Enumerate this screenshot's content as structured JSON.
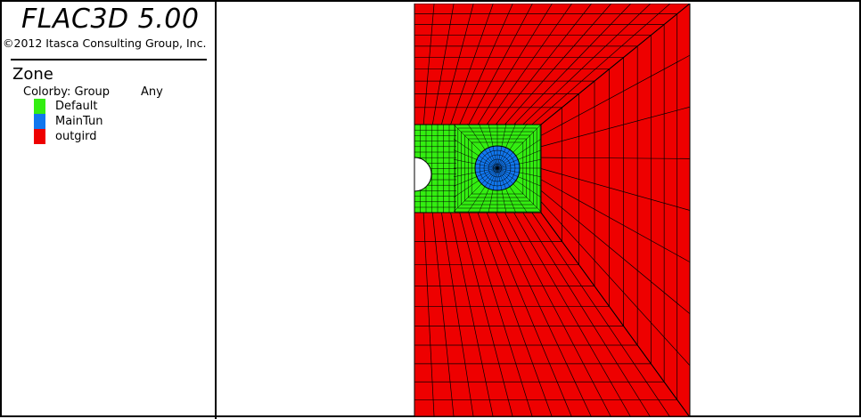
{
  "app": {
    "title": "FLAC3D 5.00",
    "copyright": "©2012 Itasca Consulting Group, Inc."
  },
  "legend": {
    "section": "Zone",
    "colorby_label": "Colorby: Group",
    "colorby_filter": "Any",
    "items": [
      {
        "label": "Default",
        "color": "#33ee11"
      },
      {
        "label": "MainTun",
        "color": "#1177ee"
      },
      {
        "label": "outgird",
        "color": "#ee0000"
      }
    ]
  },
  "colors": {
    "grid_line": "#000000",
    "background": "#ffffff"
  }
}
